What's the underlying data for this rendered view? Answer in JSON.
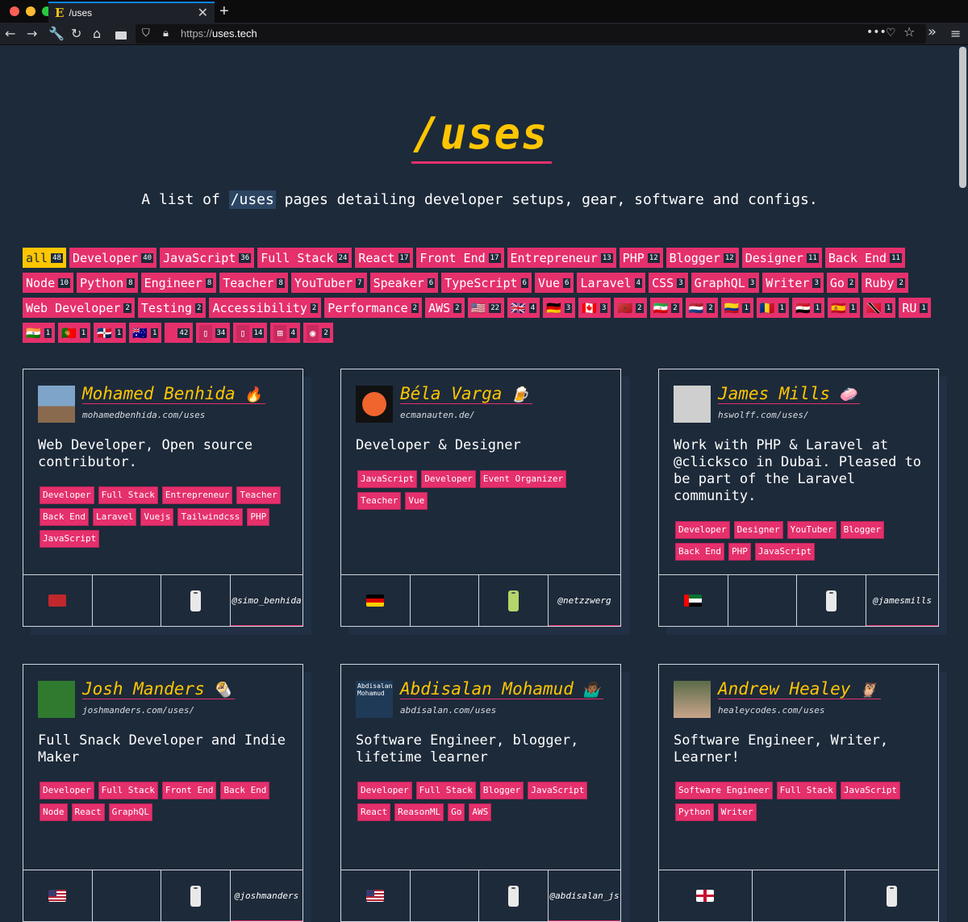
{
  "browser": {
    "tab_title": "/uses",
    "tab_favicon": "E",
    "url_scheme": "https://",
    "url_host": "uses.tech"
  },
  "page": {
    "title": "/uses",
    "subtitle_pre": "A list of ",
    "subtitle_code": "/uses",
    "subtitle_post": " pages detailing developer setups, gear, software and configs."
  },
  "filters": [
    {
      "label": "all",
      "count": "48",
      "active": true
    },
    {
      "label": "Developer",
      "count": "40"
    },
    {
      "label": "JavaScript",
      "count": "36"
    },
    {
      "label": "Full Stack",
      "count": "24"
    },
    {
      "label": "React",
      "count": "17"
    },
    {
      "label": "Front End",
      "count": "17"
    },
    {
      "label": "Entrepreneur",
      "count": "13"
    },
    {
      "label": "PHP",
      "count": "12"
    },
    {
      "label": "Blogger",
      "count": "12"
    },
    {
      "label": "Designer",
      "count": "11"
    },
    {
      "label": "Back End",
      "count": "11"
    },
    {
      "label": "Node",
      "count": "10"
    },
    {
      "label": "Python",
      "count": "8"
    },
    {
      "label": "Engineer",
      "count": "8"
    },
    {
      "label": "Teacher",
      "count": "8"
    },
    {
      "label": "YouTuber",
      "count": "7"
    },
    {
      "label": "Speaker",
      "count": "6"
    },
    {
      "label": "TypeScript",
      "count": "6"
    },
    {
      "label": "Vue",
      "count": "6"
    },
    {
      "label": "Laravel",
      "count": "4"
    },
    {
      "label": "CSS",
      "count": "3"
    },
    {
      "label": "GraphQL",
      "count": "3"
    },
    {
      "label": "Writer",
      "count": "3"
    },
    {
      "label": "Go",
      "count": "2"
    },
    {
      "label": "Ruby",
      "count": "2"
    },
    {
      "label": "Web Developer",
      "count": "2"
    },
    {
      "label": "Testing",
      "count": "2"
    },
    {
      "label": "Accessibility",
      "count": "2"
    },
    {
      "label": "Performance",
      "count": "2"
    },
    {
      "label": "AWS",
      "count": "2"
    },
    {
      "label": "🇺🇸",
      "count": "22",
      "icon": "us-flag-icon"
    },
    {
      "label": "🇬🇧",
      "count": "4",
      "icon": "uk-flag-icon"
    },
    {
      "label": "🇩🇪",
      "count": "3",
      "icon": "de-flag-icon"
    },
    {
      "label": "🇨🇦",
      "count": "3",
      "icon": "ca-flag-icon"
    },
    {
      "label": "🇲🇦",
      "count": "2",
      "icon": "ma-flag-icon"
    },
    {
      "label": "🇮🇷",
      "count": "2",
      "icon": "ir-flag-icon"
    },
    {
      "label": "🇳🇱",
      "count": "2",
      "icon": "nl-flag-icon"
    },
    {
      "label": "🇨🇴",
      "count": "1",
      "icon": "co-flag-icon"
    },
    {
      "label": "🇷🇴",
      "count": "1",
      "icon": "ro-flag-icon"
    },
    {
      "label": "🇪🇬",
      "count": "1",
      "icon": "eg-flag-icon"
    },
    {
      "label": "🇪🇸",
      "count": "1",
      "icon": "es-flag-icon"
    },
    {
      "label": "🇹🇹",
      "count": "1",
      "icon": "tt-flag-icon"
    },
    {
      "label": "RU",
      "count": "1",
      "icon": "ru-flag-icon"
    },
    {
      "label": "🇮🇳",
      "count": "1",
      "icon": "in-flag-icon"
    },
    {
      "label": "🇵🇹",
      "count": "1",
      "icon": "pt-flag-icon"
    },
    {
      "label": "🇩🇴",
      "count": "1",
      "icon": "do-flag-icon"
    },
    {
      "label": "🇦🇺",
      "count": "1",
      "icon": "au-flag-icon"
    },
    {
      "label": "",
      "count": "42",
      "icon": "apple-icon"
    },
    {
      "label": "",
      "count": "34",
      "icon": "iphone-icon"
    },
    {
      "label": "",
      "count": "14",
      "icon": "android-icon"
    },
    {
      "label": "",
      "count": "4",
      "icon": "windows-icon"
    },
    {
      "label": "",
      "count": "2",
      "icon": "ubuntu-icon"
    }
  ],
  "cards": [
    {
      "name": "Mohamed Benhida",
      "emoji": "🔥",
      "site": "mohamedbenhida.com/uses",
      "desc": "Web Developer, Open source contributor.",
      "tags": [
        "Developer",
        "Full Stack",
        "Entrepreneur",
        "Teacher",
        "Back End",
        "Laravel",
        "Vuejs",
        "Tailwindcss",
        "PHP",
        "JavaScript"
      ],
      "flag": "ma",
      "handle": "@simo_benhida"
    },
    {
      "name": "Béla Varga",
      "emoji": "🍺",
      "site": "ecmanauten.de/",
      "desc": "Developer & Designer",
      "tags": [
        "JavaScript",
        "Developer",
        "Event Organizer",
        "Teacher",
        "Vue"
      ],
      "flag": "de",
      "handle": "@netzzwerg"
    },
    {
      "name": "James Mills",
      "emoji": "🧼",
      "site": "hswolff.com/uses/",
      "desc": "Work with PHP & Laravel at @clicksco in Dubai. Pleased to be part of the Laravel community.",
      "tags": [
        "Developer",
        "Designer",
        "YouTuber",
        "Blogger",
        "Back End",
        "PHP",
        "JavaScript"
      ],
      "flag": "ae",
      "handle": "@jamesmills"
    },
    {
      "name": "Josh Manders",
      "emoji": "🌯",
      "site": "joshmanders.com/uses/",
      "desc": "Full Snack Developer and Indie Maker",
      "tags": [
        "Developer",
        "Full Stack",
        "Front End",
        "Back End",
        "Node",
        "React",
        "GraphQL"
      ],
      "flag": "us",
      "handle": "@joshmanders"
    },
    {
      "name": "Abdisalan Mohamud",
      "emoji": "🤷🏾‍♂️",
      "site": "abdisalan.com/uses",
      "desc": "Software Engineer, blogger, lifetime learner",
      "tags": [
        "Developer",
        "Full Stack",
        "Blogger",
        "JavaScript",
        "React",
        "ReasonML",
        "Go",
        "AWS"
      ],
      "flag": "us",
      "handle": "@abdisalan_js",
      "avatar_text": "Abdisalan Mohamud"
    },
    {
      "name": "Andrew Healey",
      "emoji": "🦉",
      "site": "healeycodes.com/uses",
      "desc": "Software Engineer, Writer, Learner!",
      "tags": [
        "Software Engineer",
        "Full Stack",
        "JavaScript",
        "Python",
        "Writer"
      ],
      "flag": "gb",
      "handle": ""
    }
  ]
}
